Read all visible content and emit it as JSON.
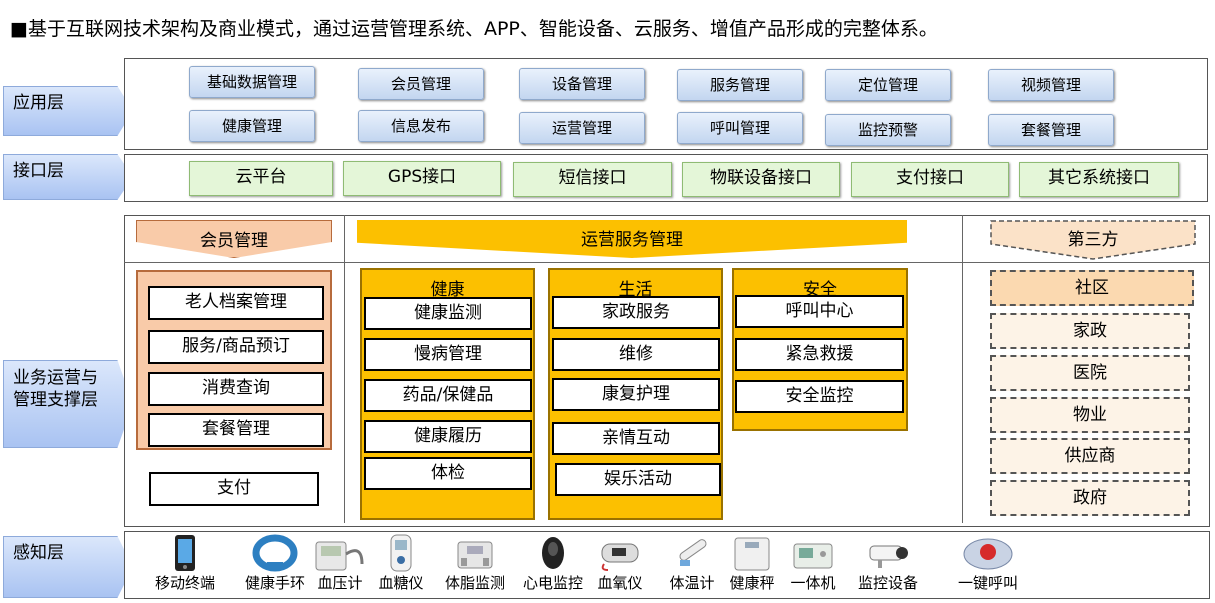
{
  "title": "■基于互联网技术架构及商业模式，通过运营管理系统、APP、智能设备、云服务、增值产品形成的完整体系。",
  "layers": {
    "app": "应用层",
    "interface": "接口层",
    "business": "业务运营与管理支撑层",
    "sensing": "感知层"
  },
  "app_row1": [
    "基础数据管理",
    "会员管理",
    "设备管理",
    "服务管理",
    "定位管理",
    "视频管理"
  ],
  "app_row2": [
    "健康管理",
    "信息发布",
    "运营管理",
    "呼叫管理",
    "监控预警",
    "套餐管理"
  ],
  "interfaces": [
    "云平台",
    "GPS接口",
    "短信接口",
    "物联设备接口",
    "支付接口",
    "其它系统接口"
  ],
  "member": {
    "header": "会员管理",
    "items": [
      "老人档案管理",
      "服务/商品预订",
      "消费查询",
      "套餐管理"
    ],
    "pay": "支付"
  },
  "ops": {
    "header": "运营服务管理",
    "health": {
      "title": "健康",
      "items": [
        "健康监测",
        "慢病管理",
        "药品/保健品",
        "健康履历",
        "体检"
      ]
    },
    "life": {
      "title": "生活",
      "items": [
        "家政服务",
        "维修",
        "康复护理",
        "亲情互动",
        "娱乐活动"
      ]
    },
    "safety": {
      "title": "安全",
      "items": [
        "呼叫中心",
        "紧急救援",
        "安全监控"
      ]
    }
  },
  "third": {
    "header": "第三方",
    "items": [
      "社区",
      "家政",
      "医院",
      "物业",
      "供应商",
      "政府"
    ]
  },
  "devices": [
    "移动终端",
    "健康手环",
    "血压计",
    "血糖仪",
    "体脂监测",
    "心电监控",
    "血氧仪",
    "体温计",
    "健康秤",
    "一体机",
    "监控设备",
    "一键呼叫"
  ],
  "colors": {
    "layer_arrow": "#a9c3f2",
    "interface_green": "#e4f6d8",
    "member_orange": "#f9cba9",
    "ops_yellow": "#fcc000",
    "third_dash": "#fdf3e7"
  }
}
